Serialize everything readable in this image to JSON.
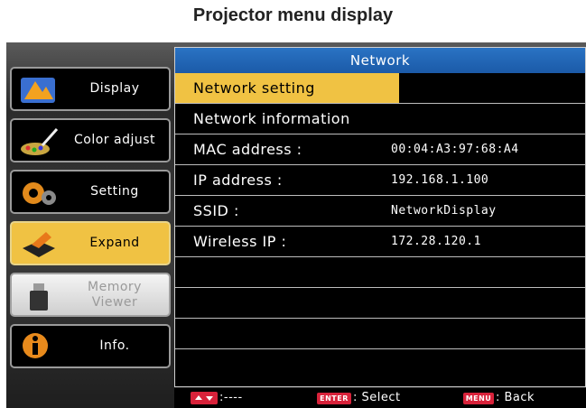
{
  "caption": "Projector menu display",
  "sidebar": {
    "items": [
      {
        "label": "Display",
        "icon": "display-icon",
        "state": "normal"
      },
      {
        "label": "Color adjust",
        "icon": "color-adjust-icon",
        "state": "normal"
      },
      {
        "label": "Setting",
        "icon": "gear-icon",
        "state": "normal"
      },
      {
        "label": "Expand",
        "icon": "expand-icon",
        "state": "selected"
      },
      {
        "label": "Memory\nViewer",
        "icon": "usb-drive-icon",
        "state": "disabled"
      },
      {
        "label": "Info.",
        "icon": "info-icon",
        "state": "normal"
      }
    ]
  },
  "panel": {
    "title": "Network",
    "rows": [
      {
        "label": "Network setting",
        "value": ""
      },
      {
        "label": "Network information",
        "value": ""
      },
      {
        "label": "MAC address :",
        "value": "00:04:A3:97:68:A4"
      },
      {
        "label": "IP address :",
        "value": "192.168.1.100"
      },
      {
        "label": "SSID :",
        "value": "NetworkDisplay"
      },
      {
        "label": "Wireless IP :",
        "value": "172.28.120.1"
      },
      {
        "label": "",
        "value": ""
      },
      {
        "label": "",
        "value": ""
      },
      {
        "label": "",
        "value": ""
      },
      {
        "label": "",
        "value": ""
      }
    ]
  },
  "footer": {
    "arrows_text": ":----",
    "enter_key": "ENTER",
    "enter_text": ": Select",
    "menu_key": "MENU",
    "menu_text": ": Back"
  },
  "colors": {
    "highlight": "#f0c243",
    "title_bar": "#1b5aa8",
    "key": "#d8223a"
  }
}
